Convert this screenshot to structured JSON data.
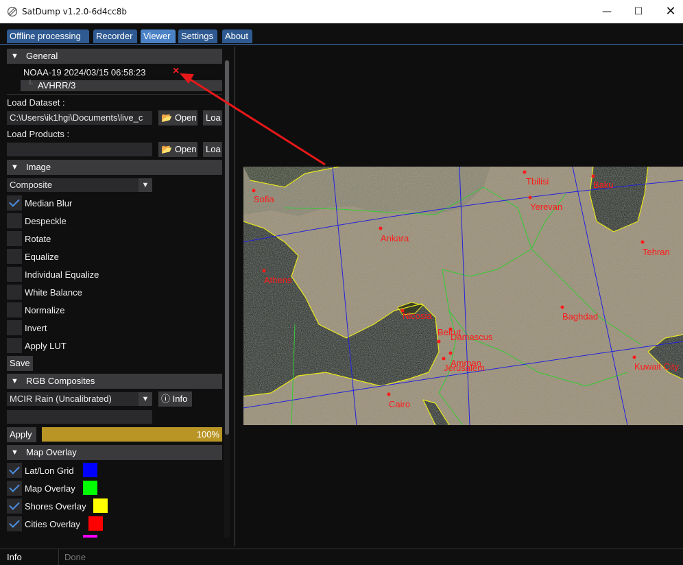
{
  "window": {
    "title": "SatDump v1.2.0-6d4cc8b"
  },
  "tabs": [
    {
      "label": "Offline processing"
    },
    {
      "label": "Recorder"
    },
    {
      "label": "Viewer"
    },
    {
      "label": "Settings"
    },
    {
      "label": "About"
    }
  ],
  "general": {
    "header": "General",
    "dataset_name": "NOAA-19 2024/03/15 06:58:23",
    "instrument": "AVHRR/3",
    "close_glyph": "×"
  },
  "load_dataset": {
    "label": "Load Dataset :",
    "value": "C:\\Users\\ik1hgi\\Documents\\live_c",
    "open_label": "Open",
    "load_label": "Loa"
  },
  "load_products": {
    "label": "Load Products :",
    "value": "",
    "open_label": "Open",
    "load_label": "Loa"
  },
  "image": {
    "header": "Image",
    "mode": "Composite",
    "options": [
      {
        "label": "Median Blur",
        "checked": true
      },
      {
        "label": "Despeckle",
        "checked": false
      },
      {
        "label": "Rotate",
        "checked": false
      },
      {
        "label": "Equalize",
        "checked": false
      },
      {
        "label": "Individual Equalize",
        "checked": false
      },
      {
        "label": "White Balance",
        "checked": false
      },
      {
        "label": "Normalize",
        "checked": false
      },
      {
        "label": "Invert",
        "checked": false
      },
      {
        "label": "Apply LUT",
        "checked": false
      }
    ],
    "save_label": "Save"
  },
  "rgb": {
    "header": "RGB Composites",
    "selected": "MCIR Rain (Uncalibrated)",
    "info_label": "Info",
    "expression": "",
    "apply_label": "Apply",
    "progress": 1.0,
    "progress_text": "100%"
  },
  "overlay": {
    "header": "Map Overlay",
    "items": [
      {
        "label": "Lat/Lon Grid",
        "checked": true,
        "color": "#0000ff"
      },
      {
        "label": "Map Overlay",
        "checked": true,
        "color": "#00ff00"
      },
      {
        "label": "Shores Overlay",
        "checked": true,
        "color": "#ffff00"
      },
      {
        "label": "Cities Overlay",
        "checked": true,
        "color": "#ff0000"
      }
    ],
    "partial_color": "#ff00ff"
  },
  "status": {
    "label": "Info",
    "message": "Done"
  },
  "map": {
    "cities": [
      "Sofia",
      "Tbilisi",
      "Baku",
      "Yerevan",
      "Ankara",
      "Tehran",
      "Athens",
      "Nicosia",
      "Baghdad",
      "Beirut",
      "Damascus",
      "Amman",
      "Jerusalem",
      "Kuwait City",
      "Cairo"
    ],
    "colors": {
      "grid": "#2020e0",
      "borders": "#33cc33",
      "shores": "#e8e81a",
      "cities": "#ff1a1a"
    }
  }
}
